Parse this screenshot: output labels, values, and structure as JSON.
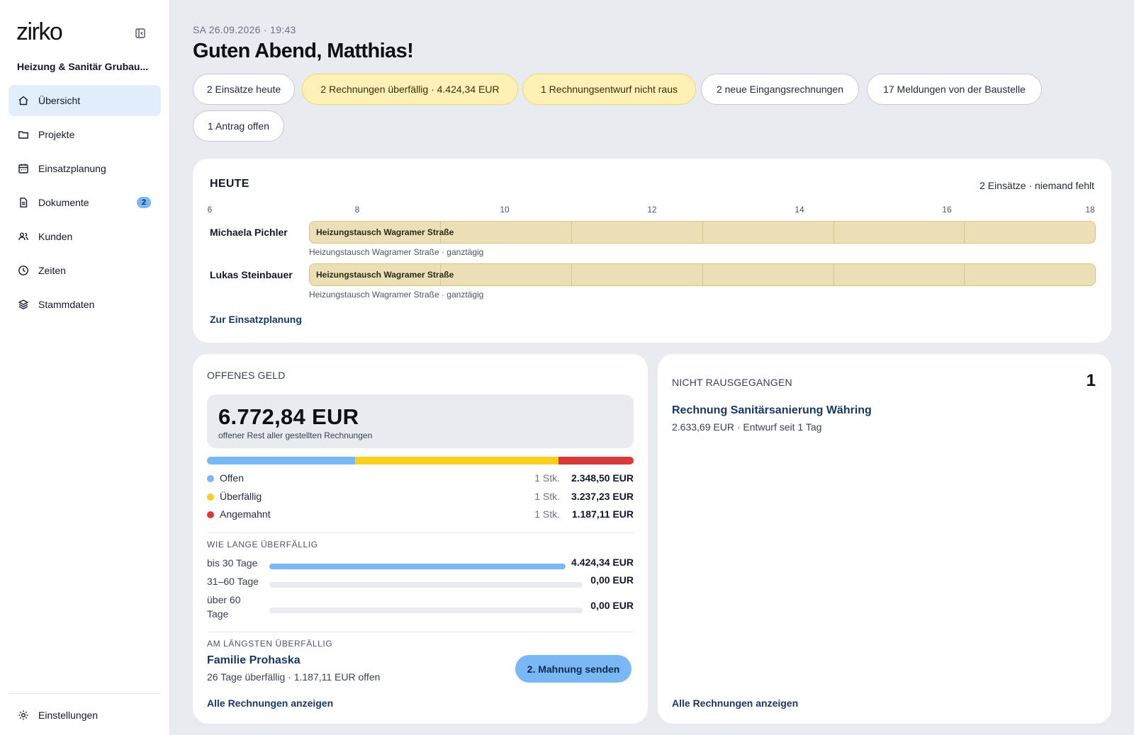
{
  "sidebar": {
    "logo": "zirko",
    "company": "Heizung & Sanitär Grubau...",
    "items": [
      {
        "label": "Übersicht",
        "icon": "home-icon",
        "active": true
      },
      {
        "label": "Projekte",
        "icon": "folder-icon"
      },
      {
        "label": "Einsatzplanung",
        "icon": "calendar-icon"
      },
      {
        "label": "Dokumente",
        "icon": "document-icon",
        "badge": "2"
      },
      {
        "label": "Kunden",
        "icon": "users-icon"
      },
      {
        "label": "Zeiten",
        "icon": "clock-icon"
      },
      {
        "label": "Stammdaten",
        "icon": "layers-icon"
      }
    ],
    "settings": "Einstellungen"
  },
  "header": {
    "datetime": "SA 26.09.2026 · 19:43",
    "greeting": "Guten Abend, Matthias!",
    "chips": [
      {
        "label": "2 Einsätze heute",
        "warn": false
      },
      {
        "label": "2 Rechnungen überfällig · 4.424,34 EUR",
        "warn": true
      },
      {
        "label": "1 Rechnungsentwurf nicht raus",
        "warn": true
      },
      {
        "label": "2 neue Eingangsrechnungen",
        "warn": false
      },
      {
        "label": "17 Meldungen von der Baustelle",
        "warn": false
      },
      {
        "label": "1 Antrag offen",
        "warn": false
      }
    ]
  },
  "today": {
    "title": "HEUTE",
    "summary": "2 Einsätze · niemand fehlt",
    "ticks": [
      "6",
      "8",
      "10",
      "12",
      "14",
      "16",
      "18"
    ],
    "rows": [
      {
        "name": "Michaela Pichler",
        "job": "Heizungstausch Wagramer Straße",
        "sub": "Heizungstausch Wagramer Straße · ganztägig"
      },
      {
        "name": "Lukas Steinbauer",
        "job": "Heizungstausch Wagramer Straße",
        "sub": "Heizungstausch Wagramer Straße · ganztägig"
      }
    ],
    "link": "Zur Einsatzplanung"
  },
  "money": {
    "title": "OFFENES GELD",
    "total": "6.772,84 EUR",
    "total_sub": "offener Rest aller gestellten Rechnungen",
    "legend": [
      {
        "name": "Offen",
        "count": "1 Stk.",
        "amount": "2.348,50 EUR",
        "color": "#7ab8f5",
        "value": 2348.5
      },
      {
        "name": "Überfällig",
        "count": "1 Stk.",
        "amount": "3.237,23 EUR",
        "color": "#f9d01e",
        "value": 3237.23
      },
      {
        "name": "Angemahnt",
        "count": "1 Stk.",
        "amount": "1.187,11 EUR",
        "color": "#d63a3a",
        "value": 1187.11
      }
    ],
    "age_title": "WIE LANGE ÜBERFÄLLIG",
    "ages": [
      {
        "label": "bis 30 Tage",
        "amount": "4.424,34 EUR",
        "fill": 1.0
      },
      {
        "label": "31–60 Tage",
        "amount": "0,00 EUR",
        "fill": 0
      },
      {
        "label": "über 60 Tage",
        "amount": "0,00 EUR",
        "fill": 0
      }
    ],
    "longest_title": "AM LÄNGSTEN ÜBERFÄLLIG",
    "customer": "Familie Prohaska",
    "customer_sub": "26 Tage überfällig · 1.187,11 EUR offen",
    "dun_button": "2. Mahnung senden",
    "link": "Alle Rechnungen anzeigen"
  },
  "notsent": {
    "title": "NICHT RAUSGEGANGEN",
    "count": "1",
    "item": "Rechnung Sanitärsanierung Währing",
    "item_sub": "2.633,69 EUR · Entwurf seit 1 Tag",
    "link": "Alle Rechnungen anzeigen"
  }
}
